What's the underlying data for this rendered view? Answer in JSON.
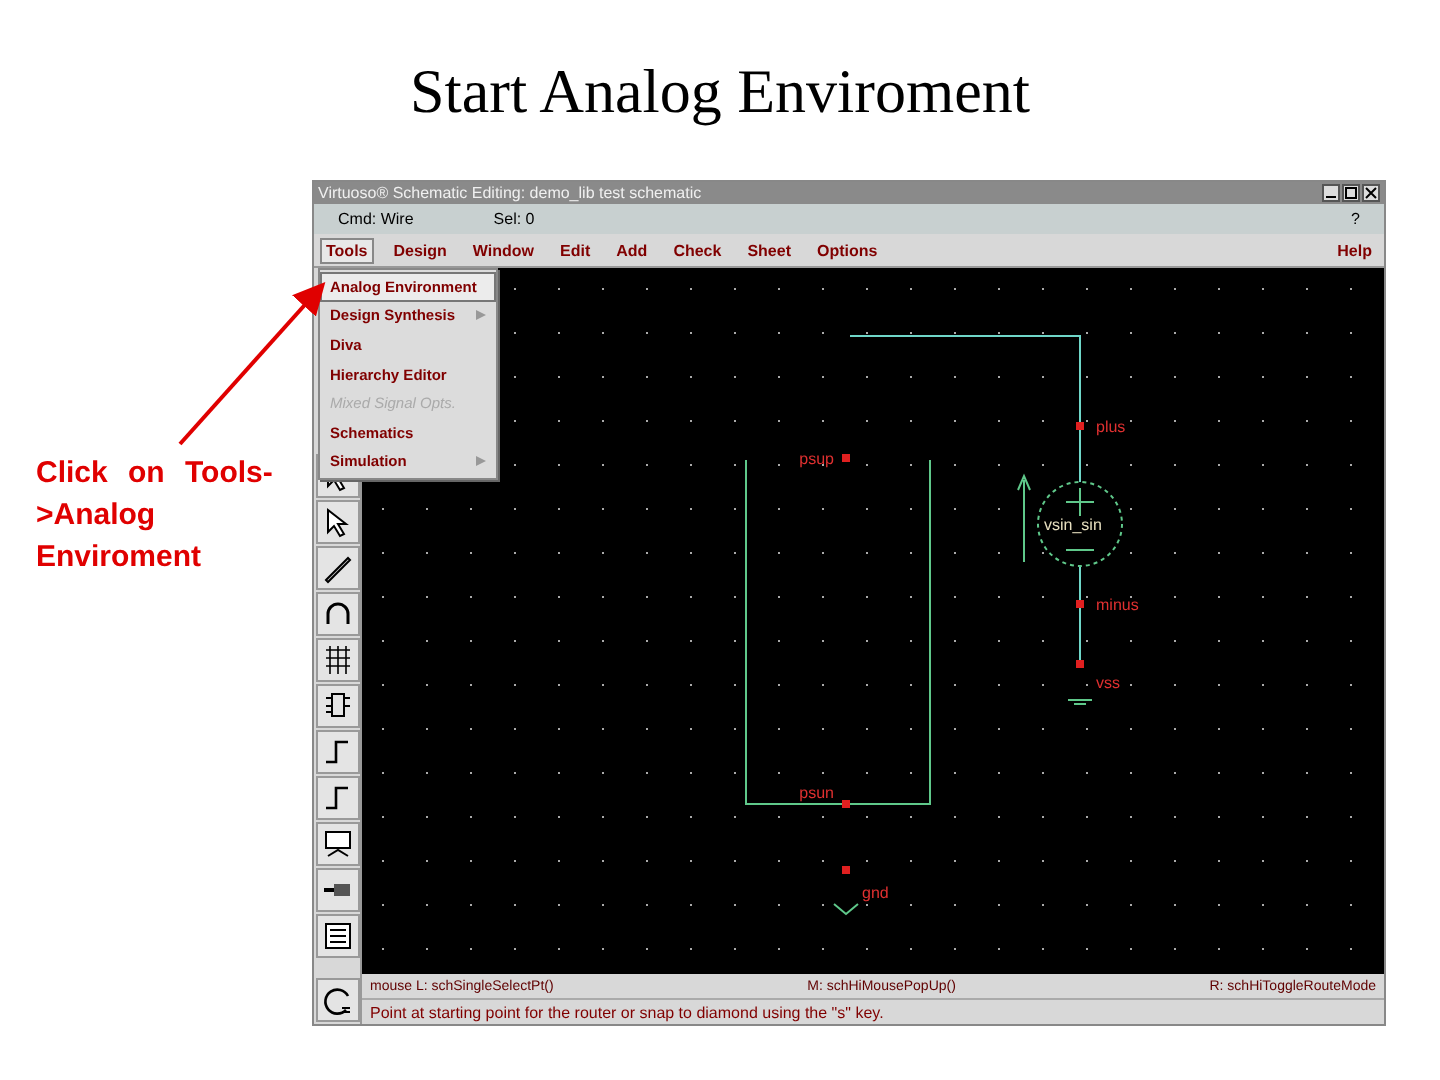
{
  "slide": {
    "title": "Start Analog Enviroment",
    "note": "Click on Tools->Analog Enviroment"
  },
  "window": {
    "title": "Virtuoso® Schematic Editing: demo_lib test schematic",
    "command": "Cmd: Wire",
    "selection": "Sel: 0",
    "help_mark": "?"
  },
  "menubar": [
    {
      "label": "Tools",
      "selected": true
    },
    {
      "label": "Design",
      "selected": false
    },
    {
      "label": "Window",
      "selected": false
    },
    {
      "label": "Edit",
      "selected": false
    },
    {
      "label": "Add",
      "selected": false
    },
    {
      "label": "Check",
      "selected": false
    },
    {
      "label": "Sheet",
      "selected": false
    },
    {
      "label": "Options",
      "selected": false
    },
    {
      "label": "Help",
      "selected": false
    }
  ],
  "menu": [
    {
      "label": "Analog Environment",
      "selected": true,
      "disabled": false,
      "submenu": false
    },
    {
      "label": "Design Synthesis",
      "selected": false,
      "disabled": false,
      "submenu": true
    },
    {
      "label": "Diva",
      "selected": false,
      "disabled": false,
      "submenu": false
    },
    {
      "label": "Hierarchy Editor",
      "selected": false,
      "disabled": false,
      "submenu": false
    },
    {
      "label": "Mixed Signal Opts.",
      "selected": false,
      "disabled": true,
      "submenu": false
    },
    {
      "label": "Schematics",
      "selected": false,
      "disabled": false,
      "submenu": false
    },
    {
      "label": "Simulation",
      "selected": false,
      "disabled": false,
      "submenu": true
    }
  ],
  "schematic": {
    "pins": [
      {
        "label": "plus"
      },
      {
        "label": "minus"
      },
      {
        "label": "vss"
      },
      {
        "label": "psup"
      },
      {
        "label": "psun"
      },
      {
        "label": "gnd"
      }
    ],
    "source_label": "vsin_sin"
  },
  "status": {
    "mouse_left": "mouse L: schSingleSelectPt()",
    "mouse_middle": "M: schHiMousePopUp()",
    "mouse_right": "R: schHiToggleRouteMode",
    "prompt": "Point at starting point for the router or snap to diamond using the \"s\" key."
  }
}
